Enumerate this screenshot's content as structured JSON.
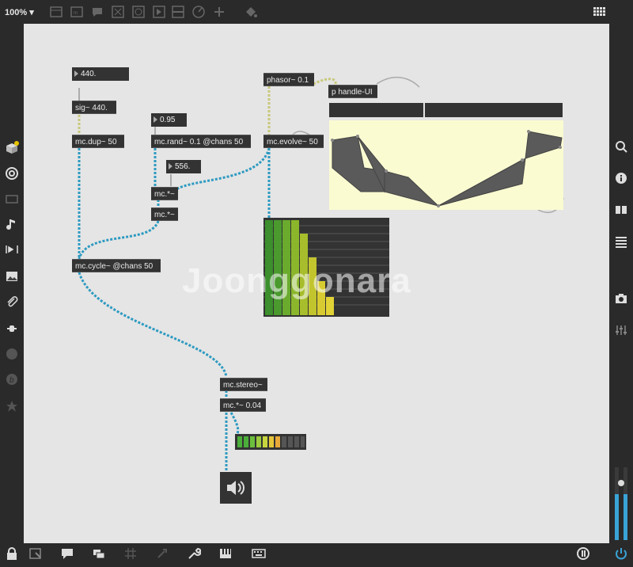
{
  "toolbar": {
    "zoom": "100%"
  },
  "objects": {
    "num_freq": "440.",
    "sig": "sig~ 440.",
    "mc_dup": "mc.dup~ 50",
    "num_rand": "0.95",
    "mc_rand": "mc.rand~ 0.1 @chans 50",
    "num_mult": "556.",
    "mult1": "mc.*~",
    "mult2": "mc.*~",
    "phasor": "phasor~ 0.1",
    "handle": "p handle-UI",
    "mc_evolve": "mc.evolve~ 50",
    "mc_cycle": "mc.cycle~ @chans 50",
    "mc_stereo": "mc.stereo~",
    "mc_gain": "mc.*~ 0.04"
  },
  "watermark": "Joonggonara",
  "colors": {
    "canvas": "#e5e5e5",
    "chrome": "#2a2a2a",
    "object": "#333333",
    "mc_cable": "#3aa3c4",
    "signal_cable": "#c8c87a",
    "function_bg": "#fbfbd2"
  }
}
